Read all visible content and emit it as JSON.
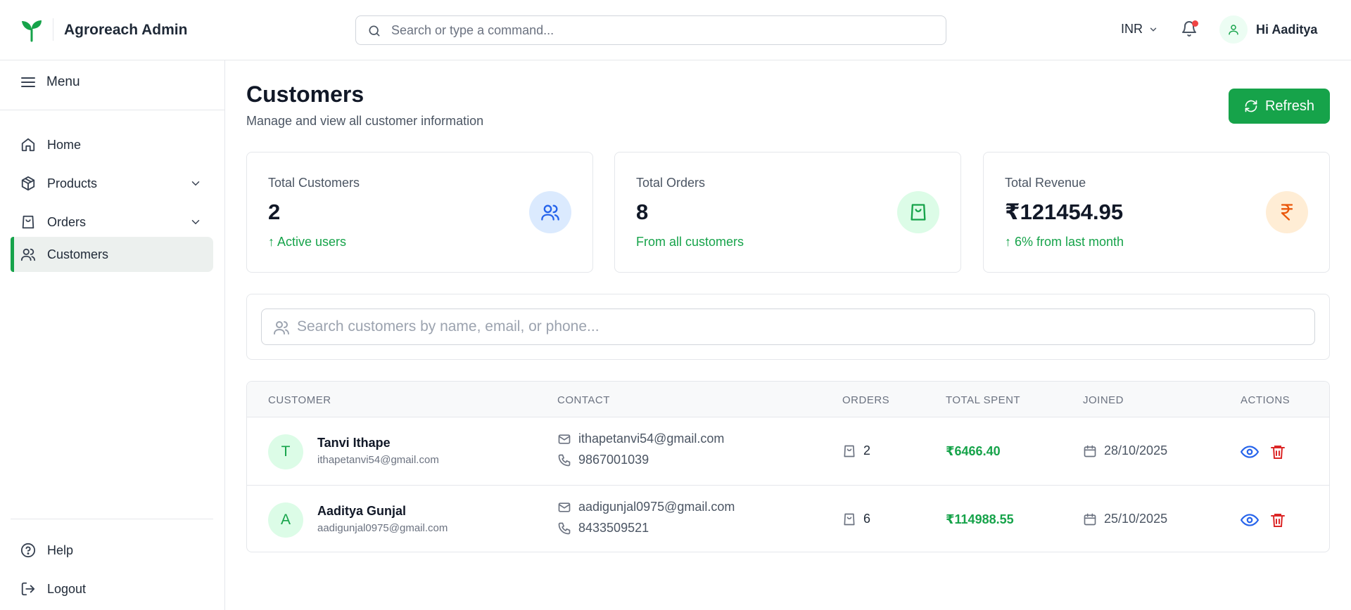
{
  "header": {
    "brand": "Agroreach Admin",
    "search_placeholder": "Search or type a command...",
    "currency": "INR",
    "greeting": "Hi Aaditya"
  },
  "sidebar": {
    "menu_label": "Menu",
    "items": [
      {
        "label": "Home",
        "icon": "home-icon"
      },
      {
        "label": "Products",
        "icon": "box-icon"
      },
      {
        "label": "Orders",
        "icon": "bag-icon"
      },
      {
        "label": "Customers",
        "icon": "users-icon"
      }
    ],
    "bottom_items": [
      {
        "label": "Help",
        "icon": "help-icon"
      },
      {
        "label": "Logout",
        "icon": "logout-icon"
      }
    ]
  },
  "page": {
    "title": "Customers",
    "subtitle": "Manage and view all customer information",
    "refresh_label": "Refresh"
  },
  "stats": [
    {
      "label": "Total Customers",
      "value": "2",
      "note": "↑ Active users",
      "icon": "users-icon",
      "color": "#2563eb",
      "bg": "#dbeafe"
    },
    {
      "label": "Total Orders",
      "value": "8",
      "note": "From all customers",
      "icon": "bag-icon",
      "color": "#16a34a",
      "bg": "#dcfce7"
    },
    {
      "label": "Total Revenue",
      "value": "₹121454.95",
      "note": "↑ 6% from last month",
      "icon": "rupee-icon",
      "color": "#ea580c",
      "bg": "#ffedd5"
    }
  ],
  "customer_search": {
    "placeholder": "Search customers by name, email, or phone..."
  },
  "table": {
    "headers": [
      "CUSTOMER",
      "CONTACT",
      "ORDERS",
      "TOTAL SPENT",
      "JOINED",
      "ACTIONS"
    ],
    "rows": [
      {
        "initial": "T",
        "name": "Tanvi Ithape",
        "email": "ithapetanvi54@gmail.com",
        "contact_email": "ithapetanvi54@gmail.com",
        "phone": "9867001039",
        "orders": "2",
        "spent": "₹6466.40",
        "joined": "28/10/2025"
      },
      {
        "initial": "A",
        "name": "Aaditya Gunjal",
        "email": "aadigunjal0975@gmail.com",
        "contact_email": "aadigunjal0975@gmail.com",
        "phone": "8433509521",
        "orders": "6",
        "spent": "₹114988.55",
        "joined": "25/10/2025"
      }
    ]
  },
  "colors": {
    "accent": "#16a34a",
    "view": "#2563eb",
    "delete": "#dc2626"
  }
}
